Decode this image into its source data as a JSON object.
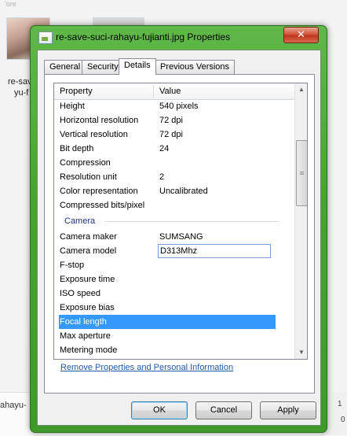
{
  "explorer": {
    "top_text": "'ore",
    "thumb1_label_line1": "re-sav",
    "thumb1_label_line2": "yu-f",
    "bottom_left_text": "ahayu-",
    "bottom_right_text": "1",
    "bottom_right_num": "0"
  },
  "window": {
    "title": "re-save-suci-rahayu-fujianti.jpg Properties",
    "close_label": "✕"
  },
  "tabs": [
    {
      "label": "General"
    },
    {
      "label": "Security"
    },
    {
      "label": "Details"
    },
    {
      "label": "Previous Versions"
    }
  ],
  "active_tab": "Details",
  "columns": {
    "property": "Property",
    "value": "Value"
  },
  "rows": [
    {
      "property": "Height",
      "value": "540 pixels"
    },
    {
      "property": "Horizontal resolution",
      "value": "72 dpi"
    },
    {
      "property": "Vertical resolution",
      "value": "72 dpi"
    },
    {
      "property": "Bit depth",
      "value": "24"
    },
    {
      "property": "Compression",
      "value": ""
    },
    {
      "property": "Resolution unit",
      "value": "2"
    },
    {
      "property": "Color representation",
      "value": "Uncalibrated"
    },
    {
      "property": "Compressed bits/pixel",
      "value": ""
    }
  ],
  "camera_section": {
    "heading": "Camera",
    "rows": [
      {
        "property": "Camera maker",
        "value": "SUMSANG"
      },
      {
        "property": "Camera model",
        "value": "D313Mhz"
      },
      {
        "property": "F-stop",
        "value": ""
      },
      {
        "property": "Exposure time",
        "value": ""
      },
      {
        "property": "ISO speed",
        "value": ""
      },
      {
        "property": "Exposure bias",
        "value": ""
      },
      {
        "property": "Focal length",
        "value": ""
      },
      {
        "property": "Max aperture",
        "value": ""
      },
      {
        "property": "Metering mode",
        "value": ""
      }
    ]
  },
  "selected_row": "Focal length",
  "editing_row": "Camera model",
  "scrollbar": {
    "up_icon": "▲",
    "down_icon": "▼",
    "grip": "≡"
  },
  "remove_link": "Remove Properties and Personal Information",
  "buttons": {
    "ok": "OK",
    "cancel": "Cancel",
    "apply": "Apply"
  },
  "colors": {
    "title_bar": "#49a530",
    "selection": "#3399ff",
    "link": "#1f5aa6",
    "section_heading": "#1e3287"
  }
}
